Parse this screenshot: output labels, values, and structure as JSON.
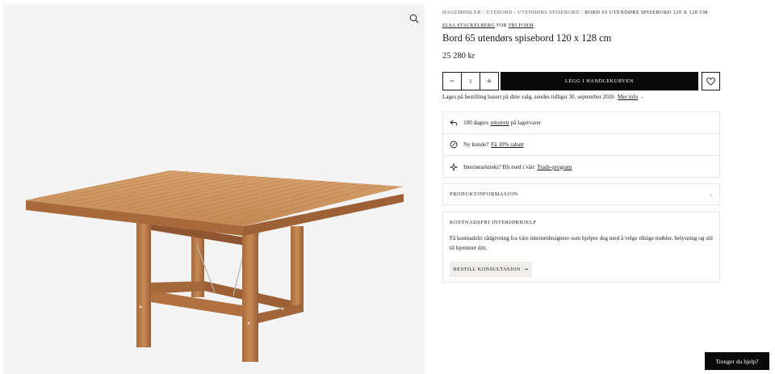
{
  "breadcrumb": [
    "Hagemøbler",
    "Utebord",
    "Utendørs spisebord",
    "Bord 65 utendørs spisebord 120 x 128 cm"
  ],
  "breadcrumb_separator": "/",
  "product": {
    "designer": "Elsa Stackelberg",
    "for_label": "for",
    "brand": "Fri Form",
    "title": "Bord 65 utendørs spisebord 120 x 128 cm",
    "price": "25 280 kr"
  },
  "cart": {
    "quantity": "1",
    "minus_symbol": "−",
    "plus_symbol": "+",
    "add_label": "Legg i handlekurven"
  },
  "delivery": {
    "text": "Lages på bestilling basert på dine valg, sendes tidligst 30. september 2026",
    "more_label": "Mer info",
    "more_chevron": "⌄"
  },
  "usps": [
    {
      "icon": "return-arrow-icon",
      "pre": "100 dagers",
      "link": "returrett",
      "post": "på lagervarer"
    },
    {
      "icon": "discount-icon",
      "pre": "Ny kunde?",
      "link": "Få 10% rabatt",
      "post": ""
    },
    {
      "icon": "sparkle-icon",
      "pre": "Interiørarkitekt? Bli med i vårt",
      "link": "Trade-program",
      "post": ""
    }
  ],
  "accordion": {
    "label": "Produktinformasjon",
    "chevron": "⌄"
  },
  "interior_help": {
    "heading": "Kostnadsfri interiørhjelp",
    "text": "Få kostnadsfri rådgivning fra våre interiørdesignere som hjelper deg med å velge riktige møbler, belysning og stil til hjemmet ditt.",
    "cta": "Bestill konsultasjon",
    "cta_arrow": "→"
  },
  "chat_button": "Trenger du hjelp?",
  "colors": {
    "primary": "#0a0a0a",
    "border": "#e6e6e6",
    "gallery_bg": "#f4f4f4",
    "teak": "#c8935c"
  }
}
